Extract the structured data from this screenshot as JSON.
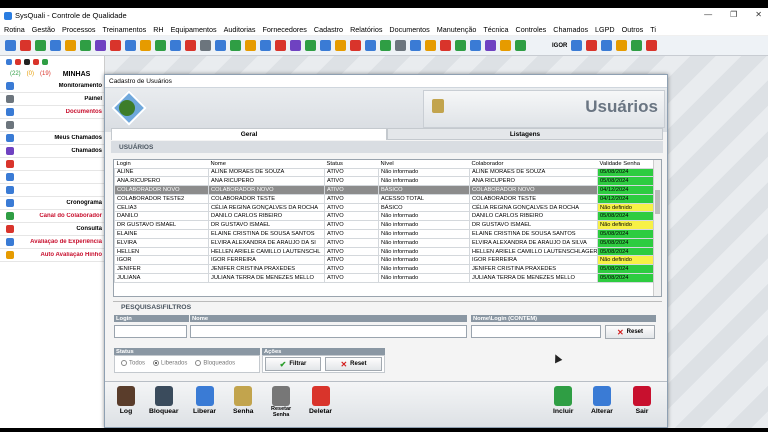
{
  "window": {
    "title": "SysQuali - Controle de Qualidade",
    "controls": [
      "—",
      "❐",
      "✕"
    ]
  },
  "menu": [
    "Rotina",
    "Gestão",
    "Processos",
    "Treinamentos",
    "RH",
    "Equipamentos",
    "Auditorias",
    "Fornecedores",
    "Cadastro",
    "Relatórios",
    "Documentos",
    "Manutenção",
    "Técnica",
    "Controles",
    "Chamados",
    "LGPD",
    "Outros",
    "Ti"
  ],
  "toolbar": {
    "user_label": "IGOR",
    "icon_colors": [
      "#3a7bd5",
      "#d9342b",
      "#2f9e44",
      "#3a7bd5",
      "#e69b00",
      "#2f9e44",
      "#6f42c1",
      "#d9342b",
      "#3a7bd5",
      "#e69b00",
      "#2f9e44",
      "#3a7bd5",
      "#d9342b",
      "#6c757d",
      "#3a7bd5",
      "#2f9e44",
      "#e69b00",
      "#3a7bd5",
      "#d9342b",
      "#6f42c1",
      "#2f9e44",
      "#3a7bd5",
      "#e69b00",
      "#d9342b",
      "#3a7bd5",
      "#2f9e44",
      "#6c757d",
      "#3a7bd5",
      "#e69b00",
      "#d9342b",
      "#2f9e44",
      "#3a7bd5",
      "#6f42c1",
      "#e69b00",
      "#2f9e44",
      "#3a7bd5",
      "#d9342b",
      "#3a7bd5",
      "#e69b00",
      "#2f9e44",
      "#d9342b"
    ]
  },
  "sidebar": {
    "counts": [
      "(22)",
      "(0)",
      "(19)"
    ],
    "title_fragment": "MINHAS",
    "items": [
      {
        "label": "Monitoramento",
        "red": false,
        "color": "#3a7bd5"
      },
      {
        "label": "Painel",
        "red": false,
        "color": "#6c757d"
      },
      {
        "label": "Documentos",
        "red": true,
        "color": "#3a7bd5"
      },
      {
        "label": "",
        "red": false,
        "color": "#6c757d"
      },
      {
        "label": "Meus Chamados",
        "red": false,
        "color": "#3a7bd5"
      },
      {
        "label": "Chamados",
        "red": false,
        "color": "#6f42c1"
      },
      {
        "label": "",
        "red": false,
        "color": "#d9342b"
      },
      {
        "label": "",
        "red": false,
        "color": "#3a7bd5"
      },
      {
        "label": "",
        "red": false,
        "color": "#3a7bd5"
      },
      {
        "label": "Cronograma",
        "red": false,
        "color": "#3a7bd5"
      },
      {
        "label": "Canal do Colaborador",
        "red": true,
        "color": "#2f9e44"
      },
      {
        "label": "Consulta",
        "red": false,
        "color": "#d9342b"
      },
      {
        "label": "Avaliação de Experiência",
        "red": true,
        "color": "#3a7bd5"
      },
      {
        "label": "Auto Avaliação Hinho",
        "red": true,
        "color": "#e69b00"
      }
    ]
  },
  "dialog": {
    "title": "Cadastro de Usuários",
    "header_title": "Usuários",
    "tabs": [
      "Geral",
      "Listagens"
    ],
    "section": "USUÁRIOS",
    "columns": [
      "Login",
      "Nome",
      "Status",
      "Nível",
      "Colaborador",
      "Validade Senha"
    ],
    "rows": [
      {
        "login": "ALINE",
        "nome": "ALINE MORAES DE SOUZA",
        "status": "ATIVO",
        "nivel": "Não informado",
        "colaborador": "ALINE MORAES DE SOUZA",
        "validade": "05/08/2024",
        "v": "green",
        "sel": false
      },
      {
        "login": "ANA.RICUPERO",
        "nome": "ANA RICUPERO",
        "status": "ATIVO",
        "nivel": "Não informado",
        "colaborador": "ANA RICUPERO",
        "validade": "05/08/2024",
        "v": "green",
        "sel": false
      },
      {
        "login": "COLABORADOR NOVO",
        "nome": "COLABORADOR NOVO",
        "status": "ATIVO",
        "nivel": "BÁSICO",
        "colaborador": "COLABORADOR NOVO",
        "validade": "04/12/2024",
        "v": "green",
        "sel": true
      },
      {
        "login": "COLABORADOR TESTE2",
        "nome": "COLABORADOR TESTE",
        "status": "ATIVO",
        "nivel": "ACESSO TOTAL",
        "colaborador": "COLABORADOR TESTE",
        "validade": "04/12/2024",
        "v": "green",
        "sel": false
      },
      {
        "login": "CELIA3",
        "nome": "CÉLIA REGINA GONÇALVES DA ROCHA",
        "status": "ATIVO",
        "nivel": "BÁSICO",
        "colaborador": "CÉLIA REGINA GONÇALVES DA ROCHA",
        "validade": "Não definido",
        "v": "yellow",
        "sel": false
      },
      {
        "login": "DANILO",
        "nome": "DANILO CARLOS RIBEIRO",
        "status": "ATIVO",
        "nivel": "Não informado",
        "colaborador": "DANILO CARLOS RIBEIRO",
        "validade": "05/08/2024",
        "v": "green",
        "sel": false
      },
      {
        "login": "DR GUSTAVO ISMAEL",
        "nome": "DR GUSTAVO ISMAEL",
        "status": "ATIVO",
        "nivel": "Não informado",
        "colaborador": "DR GUSTAVO ISMAEL",
        "validade": "Não definido",
        "v": "yellow",
        "sel": false
      },
      {
        "login": "ELAINE",
        "nome": "ELAINE CRISTINA DE SOUSA SANTOS",
        "status": "ATIVO",
        "nivel": "Não informado",
        "colaborador": "ELAINE CRISTINA DE SOUSA SANTOS",
        "validade": "05/08/2024",
        "v": "green",
        "sel": false
      },
      {
        "login": "ELVIRA",
        "nome": "ELVIRA ALEXANDRA DE ARAUJO DA SI",
        "status": "ATIVO",
        "nivel": "Não informado",
        "colaborador": "ELVIRA ALEXANDRA DE ARAUJO DA SILVA",
        "validade": "05/08/2024",
        "v": "green",
        "sel": false
      },
      {
        "login": "HELLEN",
        "nome": "HELLEN ARIELE CAMILLO LAUTENSCHL",
        "status": "ATIVO",
        "nivel": "Não informado",
        "colaborador": "HELLEN ARIELE CAMILLO LAUTENSCHLAGER",
        "validade": "05/08/2024",
        "v": "green",
        "sel": false
      },
      {
        "login": "IGOR",
        "nome": "IGOR FERREIRA",
        "status": "ATIVO",
        "nivel": "Não informado",
        "colaborador": "IGOR FERREIRA",
        "validade": "Não definido",
        "v": "yellow",
        "sel": false
      },
      {
        "login": "JENIFER",
        "nome": "JENIFER CRISTINA PRAXEDES",
        "status": "ATIVO",
        "nivel": "Não informado",
        "colaborador": "JENIFER CRISTINA PRAXEDES",
        "validade": "05/08/2024",
        "v": "green",
        "sel": false
      },
      {
        "login": "JULIANA",
        "nome": "JULIANA TERRA DE MENEZES MELLO",
        "status": "ATIVO",
        "nivel": "Não informado",
        "colaborador": "JULIANA TERRA DE MENEZES MELLO",
        "validade": "05/08/2024",
        "v": "green",
        "sel": false
      }
    ],
    "filters": {
      "title": "PESQUISAS\\FILTROS",
      "login_label": "Login",
      "nome_label": "Nome",
      "nome_login_label": "Nome\\Login (CONTEM)",
      "reset_label": "Reset",
      "status_label": "Status",
      "status_options": [
        "Todos",
        "Liberados",
        "Bloqueados"
      ],
      "status_selected": "Liberados",
      "acoes_label": "Ações",
      "filtrar_label": "Filtrar",
      "reset2_label": "Reset"
    },
    "actions": {
      "left": [
        {
          "id": "log",
          "label": "Log",
          "color": "#5a3d2b"
        },
        {
          "id": "bloquear",
          "label": "Bloquear",
          "color": "#3a4b5c"
        },
        {
          "id": "liberar",
          "label": "Liberar",
          "color": "#3a7bd5"
        },
        {
          "id": "senha",
          "label": "Senha",
          "color": "#c2a44d"
        },
        {
          "id": "resetar-senha",
          "label": "Resetar\nSenha",
          "color": "#777777"
        },
        {
          "id": "deletar",
          "label": "Deletar",
          "color": "#d9342b"
        }
      ],
      "right": [
        {
          "id": "incluir",
          "label": "Incluir",
          "color": "#2f9e44"
        },
        {
          "id": "alterar",
          "label": "Alterar",
          "color": "#3a7bd5"
        },
        {
          "id": "sair",
          "label": "Sair",
          "color": "#c8102e"
        }
      ]
    }
  }
}
